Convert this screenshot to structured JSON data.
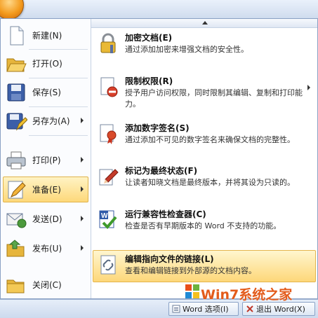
{
  "left_menu": {
    "items": [
      {
        "label": "新建(N)",
        "icon": "new-doc-icon",
        "submenu": false
      },
      {
        "label": "打开(O)",
        "icon": "open-folder-icon",
        "submenu": false
      },
      {
        "label": "保存(S)",
        "icon": "save-icon",
        "submenu": false
      },
      {
        "label": "另存为(A)",
        "icon": "save-as-icon",
        "submenu": true
      },
      {
        "label": "打印(P)",
        "icon": "print-icon",
        "submenu": true
      },
      {
        "label": "准备(E)",
        "icon": "prepare-icon",
        "submenu": true,
        "active": true
      },
      {
        "label": "发送(D)",
        "icon": "send-icon",
        "submenu": true
      },
      {
        "label": "发布(U)",
        "icon": "publish-icon",
        "submenu": true
      },
      {
        "label": "关闭(C)",
        "icon": "close-folder-icon",
        "submenu": false
      }
    ]
  },
  "right_menu": {
    "items": [
      {
        "title": "加密文档(E)",
        "desc": "通过添加加密来增强文档的安全性。",
        "icon": "lock-key-icon"
      },
      {
        "title": "限制权限(R)",
        "desc": "授予用户访问权限，同时限制其编辑、复制和打印能力。",
        "icon": "restrict-permission-icon",
        "submenu": true
      },
      {
        "title": "添加数字签名(S)",
        "desc": "通过添加不可见的数字签名来确保文档的完整性。",
        "icon": "digital-signature-icon"
      },
      {
        "title": "标记为最终状态(F)",
        "desc": "让读者知晓文档是最终版本，并将其设为只读的。",
        "icon": "mark-final-icon"
      },
      {
        "title": "运行兼容性检查器(C)",
        "desc": "检查是否有早期版本的 Word 不支持的功能。",
        "icon": "compatibility-checker-icon"
      },
      {
        "title": "编辑指向文件的链接(L)",
        "desc": "查看和编辑链接到外部源的文档内容。",
        "icon": "edit-links-icon",
        "active": true
      }
    ]
  },
  "bottom_bar": {
    "options_label": "Word 选项(I)",
    "exit_label": "退出 Word(X)"
  },
  "watermark": {
    "text": "Win7系统之家"
  }
}
